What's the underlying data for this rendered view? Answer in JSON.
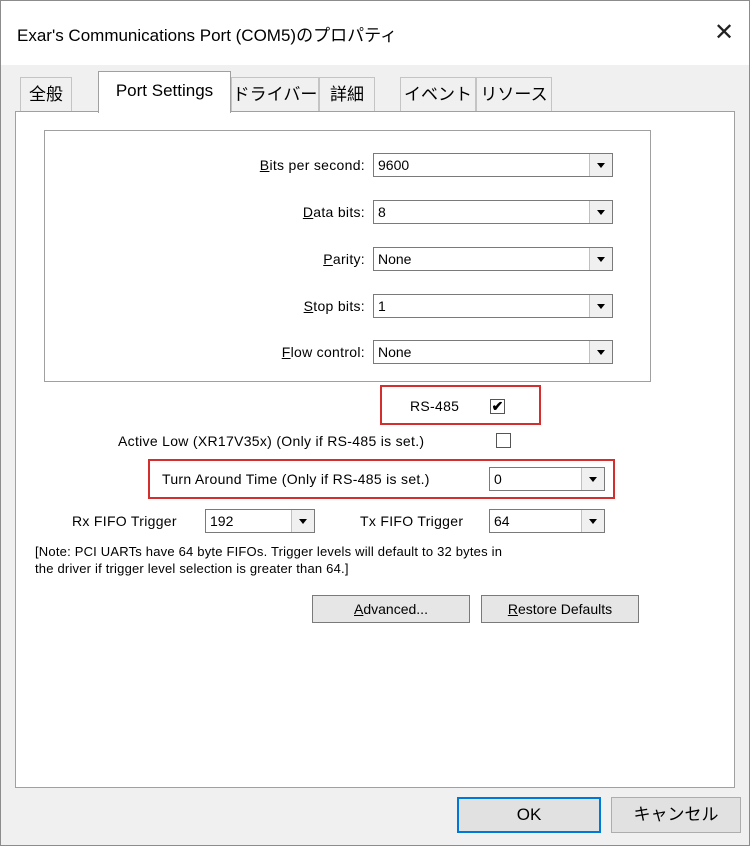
{
  "window": {
    "title": "Exar's Communications Port (COM5)のプロパティ",
    "close_glyph": "✕"
  },
  "tabs": [
    "全般",
    "Port Settings",
    "ドライバー",
    "詳細",
    "イベント",
    "リソース"
  ],
  "port_settings": {
    "bits_per_second": {
      "label_u": "B",
      "label_rest": "its per second:",
      "value": "9600"
    },
    "data_bits": {
      "label_u": "D",
      "label_rest": "ata bits:",
      "value": "8"
    },
    "parity": {
      "label_u": "P",
      "label_rest": "arity:",
      "value": "None"
    },
    "stop_bits": {
      "label_u": "S",
      "label_rest": "top bits:",
      "value": "1"
    },
    "flow_control": {
      "label_u": "F",
      "label_rest": "low control:",
      "value": "None"
    }
  },
  "rs485": {
    "label": "RS-485",
    "checked": true,
    "check_glyph": "✔"
  },
  "active_low": {
    "label": "Active Low (XR17V35x) (Only if RS-485 is set.)",
    "checked": false
  },
  "turn_around": {
    "label": "Turn Around Time (Only if RS-485 is set.)",
    "value": "0"
  },
  "rx_fifo": {
    "label": "Rx FIFO Trigger",
    "value": "192"
  },
  "tx_fifo": {
    "label": "Tx FIFO Trigger",
    "value": "64"
  },
  "note": {
    "line1": "[Note: PCI UARTs have 64 byte FIFOs. Trigger levels will default to 32 bytes in",
    "line2": "the driver if trigger level selection is greater than 64.]"
  },
  "buttons": {
    "advanced_u": "A",
    "advanced_rest": "dvanced...",
    "restore_u": "R",
    "restore_rest": "estore Defaults",
    "ok": "OK",
    "cancel": "キャンセル"
  },
  "colors": {
    "highlight_box": "#d32f2f",
    "default_button_border": "#0078d7"
  }
}
